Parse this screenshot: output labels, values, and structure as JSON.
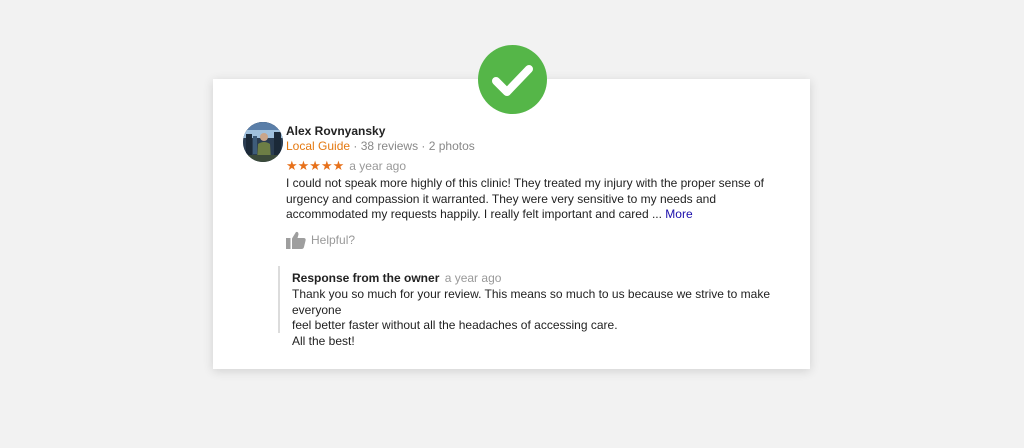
{
  "colors": {
    "page_background": "#f2f2f2",
    "card_background": "#ffffff",
    "badge_green": "#55b648",
    "star_orange": "#e7711b",
    "local_guide_orange": "#e47911",
    "link_blue": "#1a0dab"
  },
  "badge": {
    "icon": "checkmark-icon"
  },
  "review": {
    "reviewer_name": "Alex Rovnyansky",
    "local_guide_label": "Local Guide",
    "meta_details": " · 38 reviews · 2 photos",
    "rating": 5,
    "rating_max": 5,
    "stars_text": "★★★★★",
    "time": "a year ago",
    "text": "I could not speak more highly of this clinic! They treated my injury with the proper sense of urgency and compassion it warranted. They were very sensitive to my needs and accommodated my requests happily. I really felt important and cared ... ",
    "more_label": "More",
    "helpful_label": "Helpful?",
    "helpful_icon": "thumbs-up-icon"
  },
  "owner_response": {
    "title": "Response from the owner",
    "time": "a year ago",
    "line1": "Thank you so much for your review. This means so much to us because we strive to make everyone",
    "line2": "feel better faster without all the headaches of accessing care.",
    "line3": "All the best!"
  }
}
